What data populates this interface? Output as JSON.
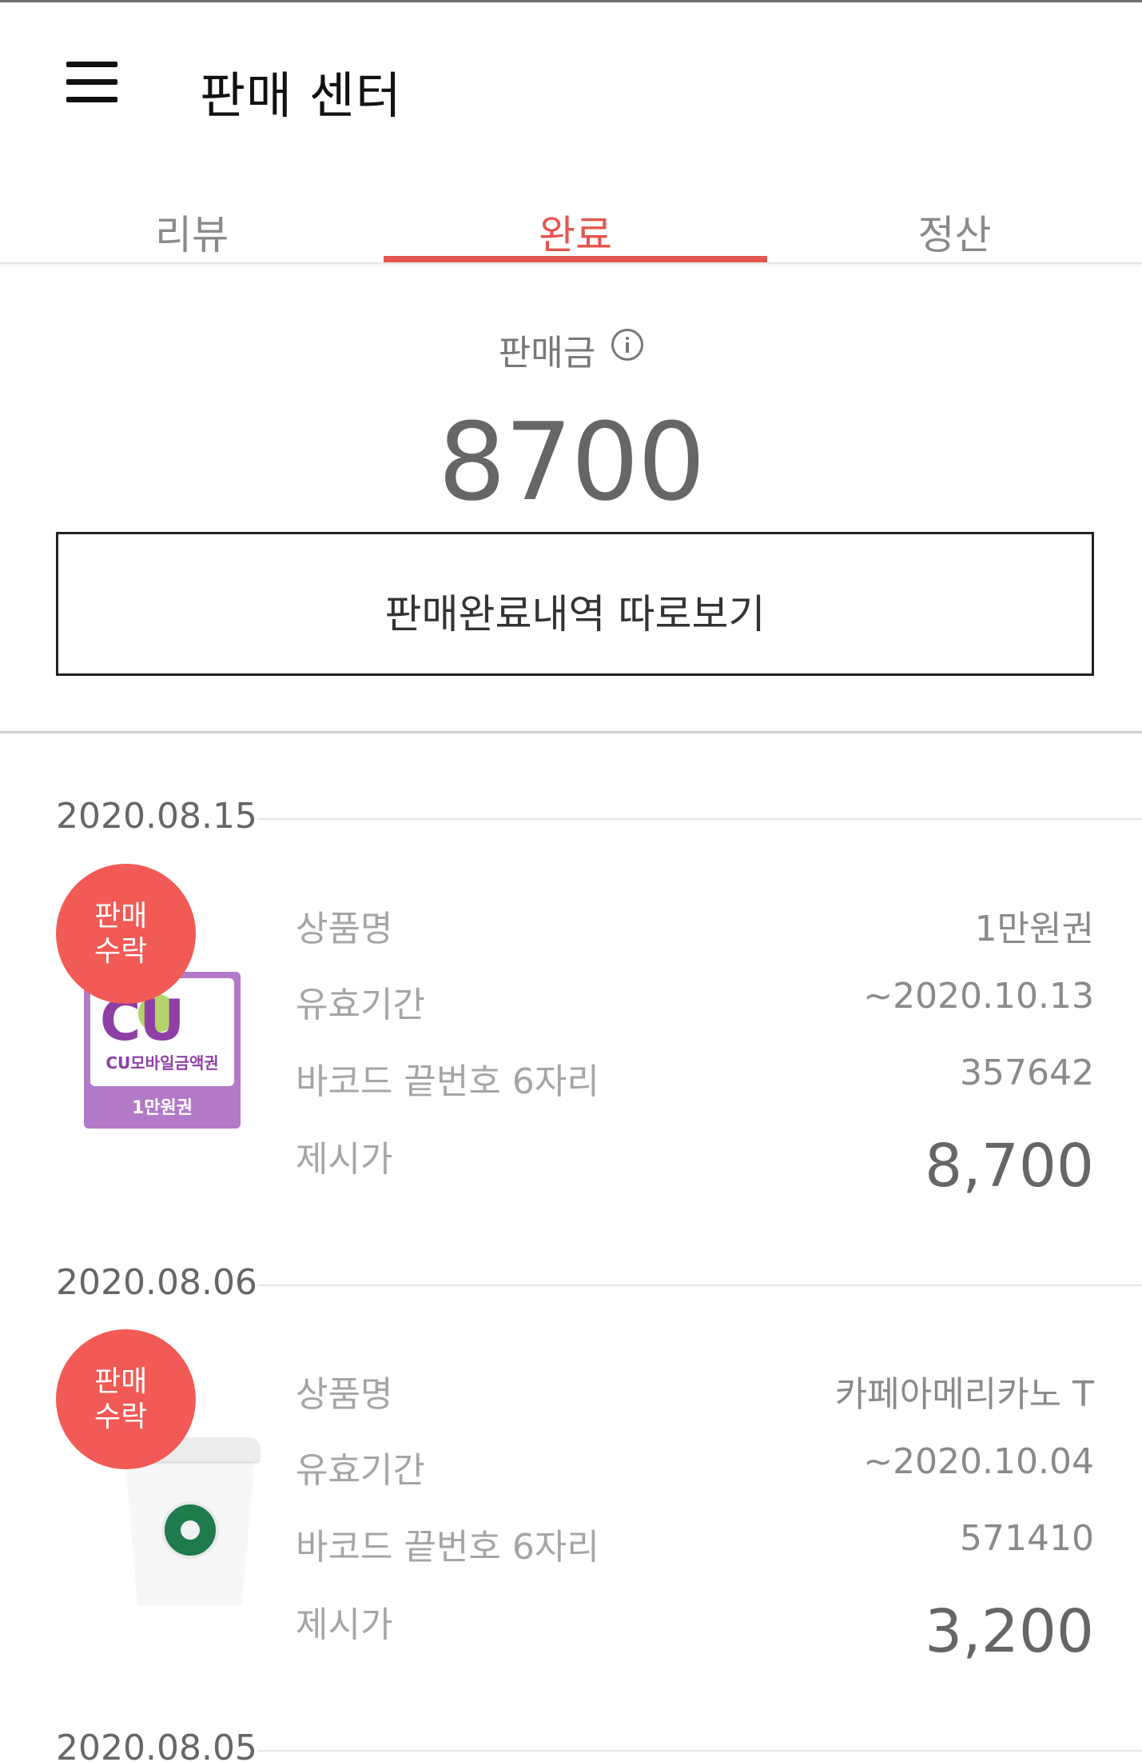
{
  "header": {
    "title": "판매 센터"
  },
  "tabs": [
    {
      "label": "리뷰"
    },
    {
      "label": "완료"
    },
    {
      "label": "정산"
    }
  ],
  "summary": {
    "label": "판매금",
    "amount": "8700",
    "history_button": "판매완료내역 따로보기"
  },
  "colors": {
    "accent": "#e4564f",
    "badge": "#f25a55"
  },
  "field_labels": {
    "product": "상품명",
    "expiry": "유효기간",
    "barcode": "바코드 끝번호 6자리",
    "price": "제시가"
  },
  "items": [
    {
      "date": "2020.08.15",
      "badge_line1": "판매",
      "badge_line2": "수락",
      "product": "1만원권",
      "expiry": "~2020.10.13",
      "barcode": "357642",
      "price": "8,700",
      "image": {
        "icon": "cu-gift-card-icon",
        "card_text": "CU모바일금액권",
        "card_bottom": "1만원권",
        "logo_text": "CU"
      }
    },
    {
      "date": "2020.08.06",
      "badge_line1": "판매",
      "badge_line2": "수락",
      "product": "카페아메리카노 T",
      "expiry": "~2020.10.04",
      "barcode": "571410",
      "price": "3,200",
      "image": {
        "icon": "coffee-cup-icon"
      }
    }
  ],
  "next_date": "2020.08.05"
}
